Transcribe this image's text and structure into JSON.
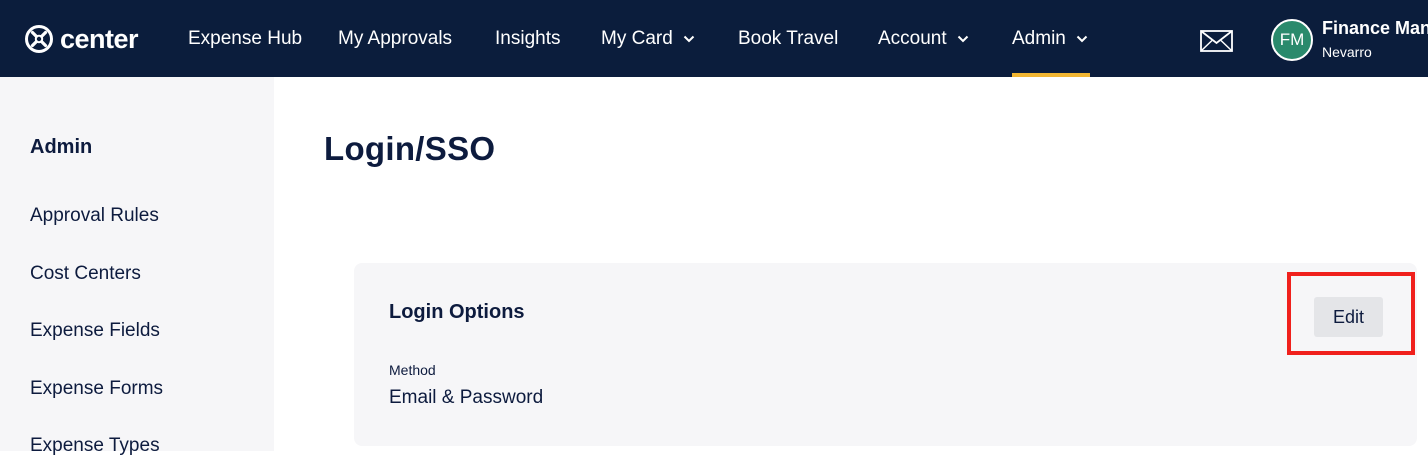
{
  "brand": {
    "name": "center"
  },
  "nav": {
    "items": [
      {
        "label": "Expense Hub"
      },
      {
        "label": "My Approvals"
      },
      {
        "label": "Insights"
      },
      {
        "label": "My Card"
      },
      {
        "label": "Book Travel"
      },
      {
        "label": "Account"
      },
      {
        "label": "Admin"
      }
    ],
    "active": "Admin",
    "accent_color": "#f2b632",
    "background_color": "#0b1d3c"
  },
  "user": {
    "initials": "FM",
    "name": "Finance Man",
    "subtitle": "Nevarro",
    "avatar_color": "#2a8a6c"
  },
  "sidebar": {
    "title": "Admin",
    "items": [
      {
        "label": "Approval Rules"
      },
      {
        "label": "Cost Centers"
      },
      {
        "label": "Expense Fields"
      },
      {
        "label": "Expense Forms"
      },
      {
        "label": "Expense Types"
      }
    ]
  },
  "page": {
    "title": "Login/SSO"
  },
  "login_options": {
    "title": "Login Options",
    "method_label": "Method",
    "method_value": "Email & Password",
    "edit_label": "Edit"
  },
  "highlight": {
    "color": "#f0201c",
    "target": "edit-button"
  }
}
